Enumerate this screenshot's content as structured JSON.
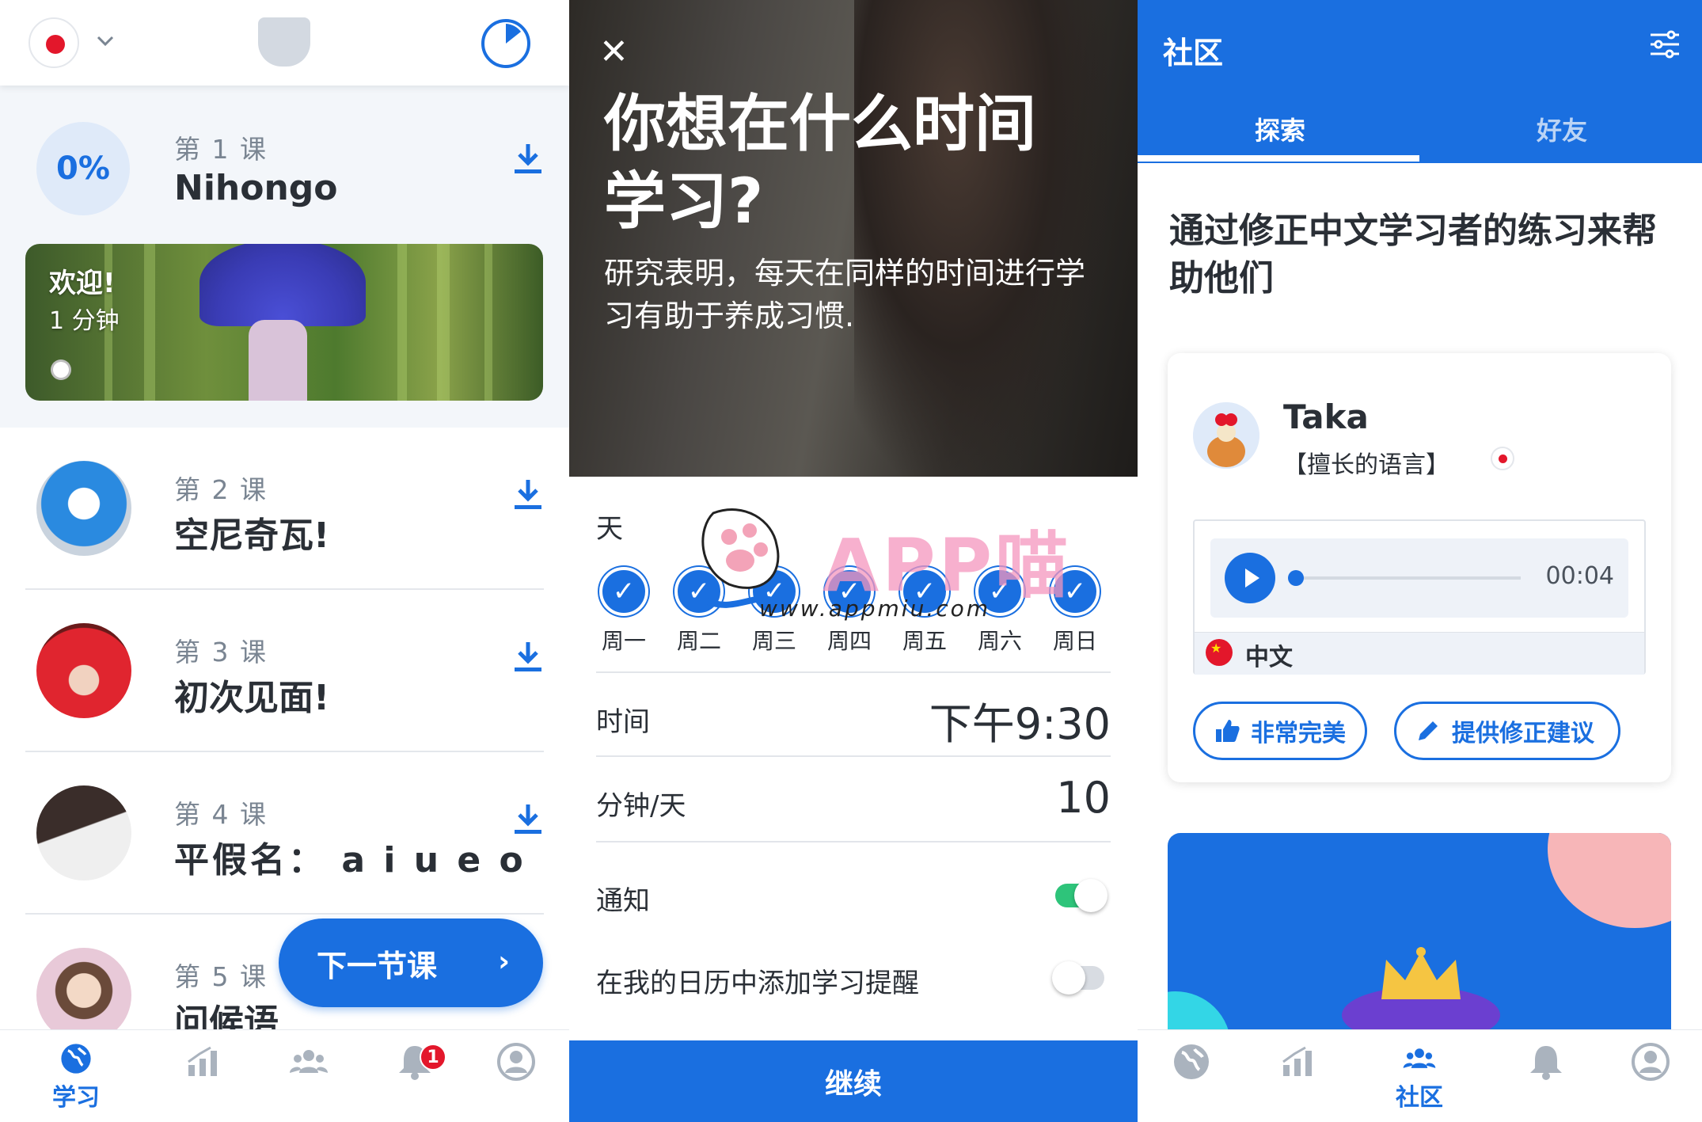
{
  "colors": {
    "accent": "#1a6fe0",
    "red": "#e3172b",
    "text": "#2a2f36",
    "muted": "#7a8592"
  },
  "learn": {
    "header_icons": [
      "japan-flag-icon",
      "chevron-down-icon",
      "shield-icon",
      "timer-icon"
    ],
    "lesson1": {
      "progress": "0%",
      "number": "第 1 课",
      "title": "Nihongo",
      "banner_title": "欢迎!",
      "banner_sub": "1 分钟"
    },
    "lessons": [
      {
        "number": "第 2 课",
        "title": "空尼奇瓦!"
      },
      {
        "number": "第 3 课",
        "title": "初次见面!"
      },
      {
        "number": "第 4 课",
        "title": "平假名： a i u e o"
      },
      {
        "number": "第 5 课",
        "title": "问候语"
      }
    ],
    "next_button": "下一节课",
    "tabs": [
      {
        "label": "学习",
        "icon": "globe-icon"
      },
      {
        "label": "",
        "icon": "stats-icon"
      },
      {
        "label": "",
        "icon": "community-icon"
      },
      {
        "label": "",
        "icon": "bell-icon"
      },
      {
        "label": "",
        "icon": "profile-icon"
      }
    ],
    "notification_count": "1"
  },
  "schedule": {
    "heading": "你想在什么时间学习?",
    "body": "研究表明，每天在同样的时间进行学习有助于养成习惯.",
    "days_label": "天",
    "days": [
      "周一",
      "周二",
      "周三",
      "周四",
      "周五",
      "周六",
      "周日"
    ],
    "time_label": "时间",
    "time_value": "下午9:30",
    "minutes_label": "分钟/天",
    "minutes_value": "10",
    "notify_label": "通知",
    "notify_on": true,
    "calendar_label": "在我的日历中添加学习提醒",
    "calendar_on": false,
    "continue": "继续",
    "watermark": {
      "text": "APP喵",
      "url": "www.appmiu.com"
    }
  },
  "community": {
    "title": "社区",
    "tabs": [
      "探索",
      "好友"
    ],
    "active_tab": "探索",
    "heading": "通过修正中文学习者的练习来帮助他们",
    "card": {
      "name": "Taka",
      "sub": "【擅长的语言】",
      "audio_time": "00:04",
      "language": "中文",
      "btn_like": "非常完美",
      "btn_correct": "提供修正建议"
    },
    "tabs_bottom": [
      {
        "label": "",
        "icon": "globe-icon"
      },
      {
        "label": "",
        "icon": "stats-icon"
      },
      {
        "label": "社区",
        "icon": "community-icon"
      },
      {
        "label": "",
        "icon": "bell-icon"
      },
      {
        "label": "",
        "icon": "profile-icon"
      }
    ]
  }
}
